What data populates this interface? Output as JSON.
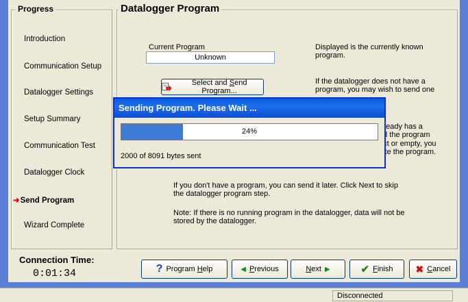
{
  "progress": {
    "title": "Progress",
    "steps": [
      {
        "label": "Introduction"
      },
      {
        "label": "Communication Setup"
      },
      {
        "label": "Datalogger Settings"
      },
      {
        "label": "Setup Summary"
      },
      {
        "label": "Communication Test"
      },
      {
        "label": "Datalogger Clock"
      },
      {
        "label": "Send Program"
      },
      {
        "label": "Wizard Complete"
      }
    ],
    "current_index": 6
  },
  "program": {
    "title": "Datalogger Program",
    "current_program_label": "Current Program",
    "current_program_value": "Unknown",
    "select_send_label_pre": "Select and ",
    "select_send_label_u": "S",
    "select_send_label_post": "end Program...",
    "desc1": "Displayed is the currently known program.",
    "desc2": "If the datalogger does not have a program, you may wish to send one",
    "desc3a": "lready has a",
    "desc3b": "nd the program",
    "desc3c": "ect or empty, you",
    "desc3d": "iate the program.",
    "desc4": "If you don't have a program, you can send it later.  Click Next to skip the datalogger program step.",
    "desc5": "Note: If there is no running program in the datalogger, data will not be stored by the datalogger."
  },
  "dialog": {
    "title": "Sending Program.  Please Wait ...",
    "percent_text": "24%",
    "progress_fraction": 0.24,
    "bytes_text": "2000 of 8091 bytes sent"
  },
  "connection": {
    "label": "Connection Time:",
    "value": "0:01:34"
  },
  "buttons": {
    "help_pre": "Program ",
    "help_u": "H",
    "help_post": "elp",
    "prev_u": "P",
    "prev_post": "revious",
    "next_u": "N",
    "next_post": "ext",
    "finish_u": "F",
    "finish_post": "inish",
    "cancel_u": "C",
    "cancel_post": "ancel"
  },
  "status": {
    "connection_state": "Disconnected"
  },
  "colors": {
    "progress_fill": "#3d7bd6",
    "titlebar": "#0b4fd1",
    "current_step_arrow": "#dd0000"
  }
}
